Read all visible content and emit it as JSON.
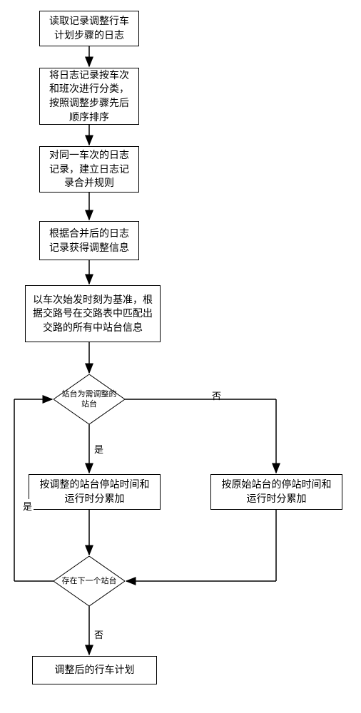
{
  "chart_data": {
    "type": "flowchart",
    "nodes": [
      {
        "id": "n1",
        "type": "process",
        "text": "读取记录调整行车\n计划步骤的日志"
      },
      {
        "id": "n2",
        "type": "process",
        "text": "将日志记录按车次\n和班次进行分类，\n按照调整步骤先后\n顺序排序"
      },
      {
        "id": "n3",
        "type": "process",
        "text": "对同一车次的日志\n记录，建立日志记\n录合并规则"
      },
      {
        "id": "n4",
        "type": "process",
        "text": "根据合并后的日志\n记录获得调整信息"
      },
      {
        "id": "n5",
        "type": "process",
        "text": "以车次始发时刻为基准，\n根据交路号在交路表中匹\n配出交路的所有中站台信\n息"
      },
      {
        "id": "d1",
        "type": "decision",
        "text": "站台为需调整\n的站台"
      },
      {
        "id": "n6",
        "type": "process",
        "text": "按调整的站台停站时间和\n运行时分累加"
      },
      {
        "id": "n7",
        "type": "process",
        "text": "按原始站台的停站时间和\n运行时分累加"
      },
      {
        "id": "d2",
        "type": "decision",
        "text": "存在下一个站\n台"
      },
      {
        "id": "n8",
        "type": "process",
        "text": "调整后的行车计划"
      }
    ],
    "edges": [
      {
        "from": "n1",
        "to": "n2"
      },
      {
        "from": "n2",
        "to": "n3"
      },
      {
        "from": "n3",
        "to": "n4"
      },
      {
        "from": "n4",
        "to": "n5"
      },
      {
        "from": "n5",
        "to": "d1"
      },
      {
        "from": "d1",
        "to": "n6",
        "label": "是"
      },
      {
        "from": "d1",
        "to": "n7",
        "label": "否"
      },
      {
        "from": "n6",
        "to": "d2"
      },
      {
        "from": "n7",
        "to": "d2"
      },
      {
        "from": "d2",
        "to": "n8",
        "label": "否"
      },
      {
        "from": "d2",
        "to": "d1",
        "label": "是"
      }
    ]
  },
  "labels": {
    "yes": "是",
    "no": "否"
  },
  "boxes": {
    "b1": "读取记录调整行车计划步骤的日志",
    "b2": "将日志记录按车次和班次进行分类，按照调整步骤先后顺序排序",
    "b3": "对同一车次的日志记录，建立日志记录合并规则",
    "b4": "根据合并后的日志记录获得调整信息",
    "b5": "以车次始发时刻为基准，根据交路号在交路表中匹配出交路的所有中站台信息",
    "d1": "站台为需调整的站台",
    "b6": "按调整的站台停站时间和运行时分累加",
    "b7": "按原始站台的停站时间和运行时分累加",
    "d2": "存在下一个站台",
    "b8": "调整后的行车计划"
  }
}
